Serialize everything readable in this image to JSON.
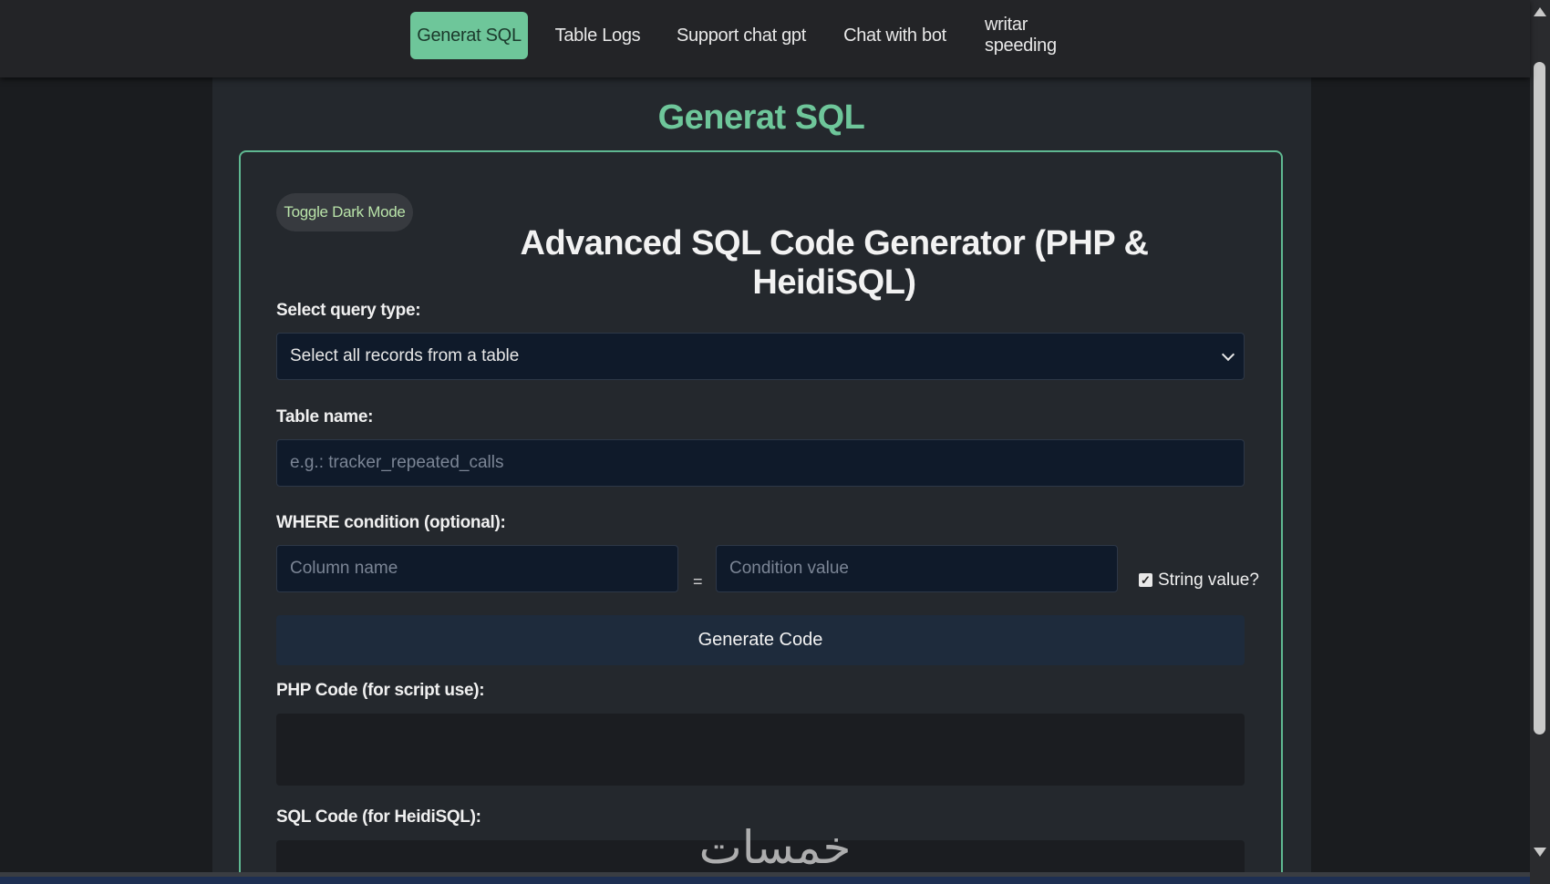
{
  "nav": {
    "items": [
      {
        "label": "Generat SQL",
        "active": true
      },
      {
        "label": "Table Logs",
        "active": false
      },
      {
        "label": "Support chat gpt",
        "active": false
      },
      {
        "label": "Chat with bot",
        "active": false
      },
      {
        "label": "writar speeding",
        "active": false
      }
    ]
  },
  "page": {
    "title": "Generat SQL"
  },
  "form": {
    "toggle_label": "Toggle Dark Mode",
    "heading": "Advanced SQL Code Generator (PHP & HeidiSQL)",
    "query_type_label": "Select query type:",
    "query_type_value": "Select all records from a table",
    "table_name_label": "Table name:",
    "table_name_placeholder": "e.g.: tracker_repeated_calls",
    "where_label": "WHERE condition (optional):",
    "column_placeholder": "Column name",
    "equals": "=",
    "condition_placeholder": "Condition value",
    "string_value_label": "String value?",
    "string_value_checked": true,
    "generate_label": "Generate Code",
    "php_label": "PHP Code (for script use):",
    "sql_label": "SQL Code (for HeidiSQL):"
  },
  "watermark": "خمسات",
  "colors": {
    "accent": "#6ec69a",
    "input_bg": "#0f1a2a",
    "button_bg": "#1e2b3c"
  }
}
